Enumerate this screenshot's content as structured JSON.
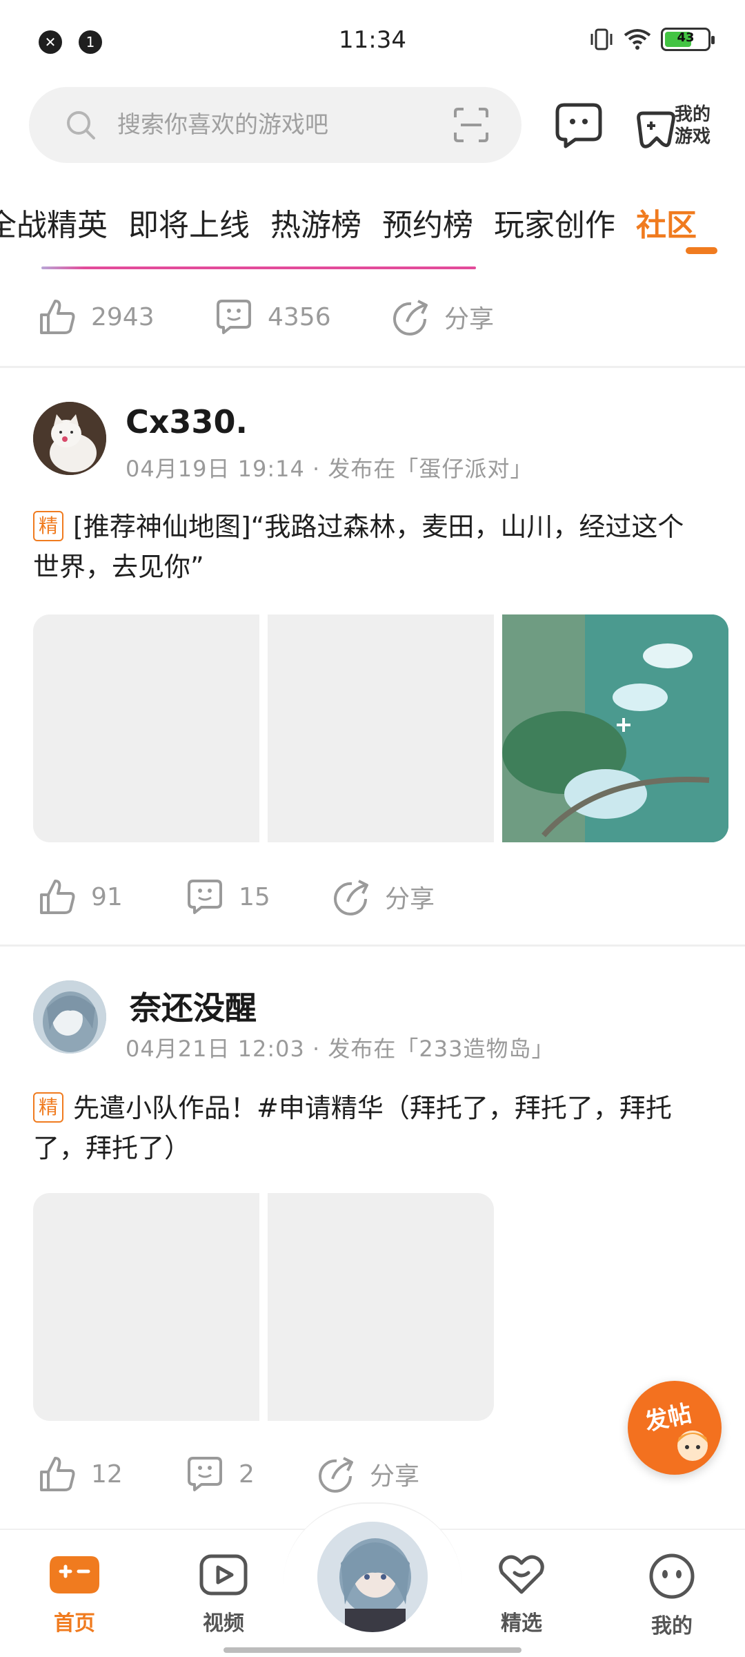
{
  "status_bar": {
    "left_icons": [
      "close-notification-icon",
      "notification-count-icon"
    ],
    "notification_count": "1",
    "time": "11:34",
    "battery_level": "43",
    "right_icons": [
      "vibrate-icon",
      "wifi-icon",
      "battery-icon"
    ]
  },
  "search": {
    "placeholder": "搜索你喜欢的游戏吧"
  },
  "header": {
    "my_games_label": "我的游戏"
  },
  "tabs": [
    {
      "label": "全战精英"
    },
    {
      "label": "即将上线"
    },
    {
      "label": "热游榜"
    },
    {
      "label": "预约榜"
    },
    {
      "label": "玩家创作"
    },
    {
      "label": "社区",
      "active": true
    }
  ],
  "prev_post": {
    "likes": "2943",
    "comments": "4356",
    "share": "分享"
  },
  "posts": [
    {
      "author": "Cx330.",
      "time": "04月19日 19:14",
      "published_in": "· 发布在「蛋仔派对」",
      "tag": "精",
      "text": "[推荐神仙地图]“我路过森林，麦田，山川，经过这个世界，去见你”",
      "likes": "91",
      "comments": "15",
      "share": "分享"
    },
    {
      "author": "奈还没醒",
      "time": "04月21日 12:03",
      "published_in": "· 发布在「233造物岛」",
      "tag": "精",
      "text": "先遣小队作品！#申请精华（拜托了，拜托了，拜托了，拜托了）",
      "likes": "12",
      "comments": "2",
      "share": "分享"
    }
  ],
  "fab": {
    "label": "发帖"
  },
  "bottom_nav": [
    {
      "label": "首页",
      "icon": "gamepad-icon",
      "active": true
    },
    {
      "label": "视频",
      "icon": "video-icon"
    },
    {
      "label": "精选",
      "icon": "heart-icon"
    },
    {
      "label": "我的",
      "icon": "profile-icon"
    }
  ],
  "colors": {
    "accent": "#f07b1f",
    "muted": "#9a9a9a"
  }
}
